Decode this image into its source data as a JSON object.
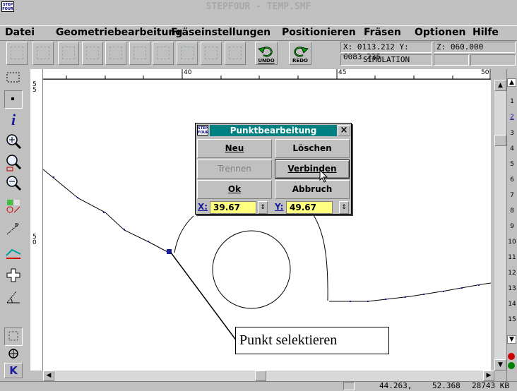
{
  "window": {
    "title": "STEPFOUR - TEMP.SMF",
    "logo_text": "STEP FOUR"
  },
  "menu": [
    "Datei",
    "Geometriebearbeitung",
    "Fräseinstellungen",
    "Positionieren",
    "Fräsen",
    "Optionen",
    "Hilfe"
  ],
  "toolbar": {
    "undo_label": "UNDO",
    "redo_label": "REDO",
    "coord_x": "X: 0113.212",
    "coord_y": "Y: 0083.235",
    "coord_z": "Z: 060.000",
    "mode": "SIMULATION"
  },
  "rulers": {
    "h_ticks": [
      "40",
      "45",
      "50"
    ],
    "v_ticks": [
      "5 5",
      "5 0"
    ]
  },
  "right_strip": [
    "1",
    "2",
    "3",
    "4",
    "5",
    "6",
    "7",
    "8",
    "9",
    "10",
    "11",
    "12",
    "13",
    "14",
    "15"
  ],
  "dialog": {
    "title": "Punktbearbeitung",
    "close": "×",
    "btn_new": "Neu",
    "btn_delete": "Löschen",
    "btn_split": "Trennen",
    "btn_connect": "Verbinden",
    "btn_ok": "Ok",
    "btn_cancel": "Abbruch",
    "x_label": "X:",
    "x_value": "39.67",
    "y_label": "Y:",
    "y_value": "49.67"
  },
  "left_tools": {
    "k_label": "K"
  },
  "callout": {
    "text": "Punkt selektieren"
  },
  "status": {
    "pos_x": "44.263,",
    "pos_y": "52.368",
    "memory": "28743 KB"
  },
  "colors": {
    "dialog_title": "#008080",
    "input_bg": "#ffff80",
    "selected_point": "#1a1aa0"
  }
}
